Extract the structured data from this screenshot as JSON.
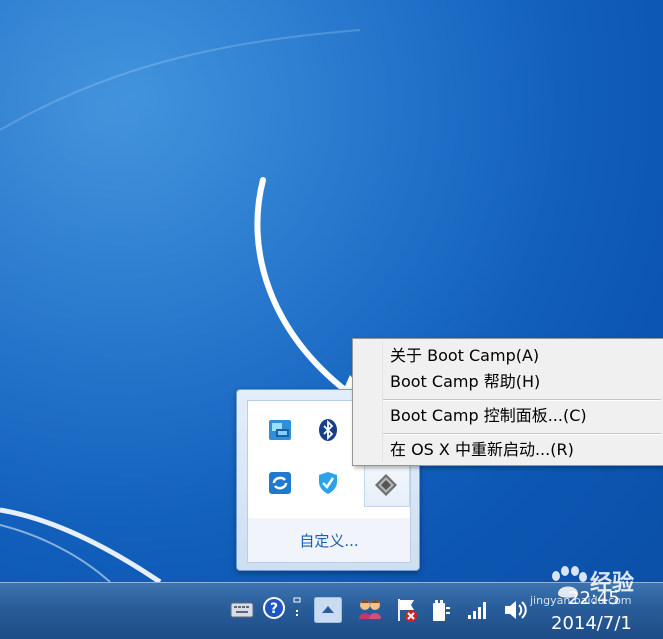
{
  "flyout": {
    "customize_label": "自定义..."
  },
  "context_menu": {
    "items": [
      {
        "label": "关于 Boot Camp(A)"
      },
      {
        "label": "Boot Camp 帮助(H)"
      },
      {
        "label": "Boot Camp 控制面板...(C)"
      },
      {
        "label": "在 OS X 中重新启动...(R)"
      }
    ]
  },
  "tray_icons": [
    "network-monitor-icon",
    "bluetooth-icon",
    "sync-icon",
    "security-shield-icon",
    "boot-camp-icon"
  ],
  "taskbar": {
    "icons": [
      "keyboard-icon",
      "help-icon",
      "expand-icon",
      "show-hidden-icons-button",
      "users-icon",
      "flag-icon",
      "power-plug-icon",
      "wifi-signal-icon",
      "volume-icon"
    ],
    "clock_time": "22:45",
    "clock_date": "2014/7/1"
  },
  "watermark": {
    "text": "经验",
    "sub": "jingyan.baidu.com"
  },
  "colors": {
    "desktop": "#1a6ec9",
    "taskbar": "#2a5f9c",
    "menu_bg": "#f0f0f0"
  }
}
